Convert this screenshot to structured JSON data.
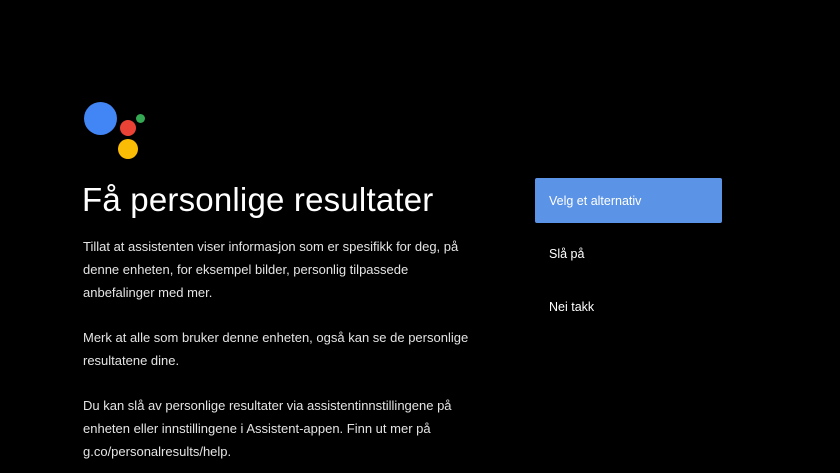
{
  "colors": {
    "background": "#000000",
    "logo_blue": "#4285f4",
    "logo_red": "#ea4335",
    "logo_yellow": "#fbbc05",
    "logo_green": "#34a853",
    "selected_option": "#5b93e6"
  },
  "logo": {
    "icon": "google-assistant-logo-icon"
  },
  "title": "Få personlige resultater",
  "paragraphs": [
    "Tillat at assistenten viser informasjon som er spesifikk for deg, på denne enheten, for eksempel bilder, personlig tilpassede anbefalinger med mer.",
    "Merk at alle som bruker denne enheten, også kan se de personlige resultatene dine.",
    "Du kan slå av personlige resultater via assistentinnstillingene på enheten eller innstillingene i Assistent-appen. Finn ut mer på g.co/personalresults/help."
  ],
  "options": [
    {
      "label": "Velg et alternativ",
      "selected": true
    },
    {
      "label": "Slå på",
      "selected": false
    },
    {
      "label": "Nei takk",
      "selected": false
    }
  ]
}
